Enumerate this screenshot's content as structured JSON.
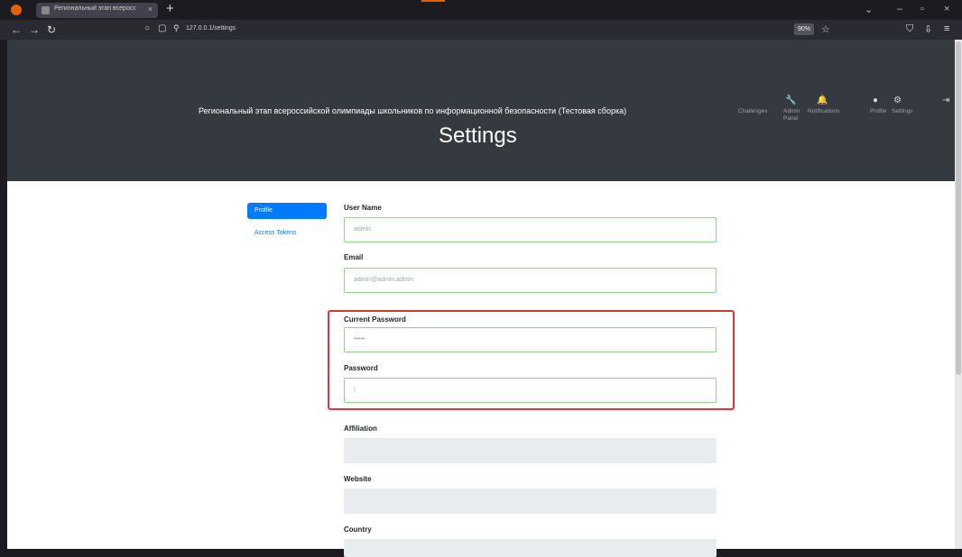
{
  "browser": {
    "tab_title": "Региональный этап всеросс",
    "url": "127.0.0.1/settings",
    "zoom": "90%"
  },
  "site": {
    "title": "Региональный этап всероссийской олимпиады школьников по информационной безопасности (Тестовая сборка)",
    "nav": [
      "Challenges",
      "Admin Panel",
      "Notifications",
      "Profile",
      "Settings"
    ]
  },
  "page": {
    "title": "Settings"
  },
  "sidebar": {
    "profile": "Profile",
    "tokens": "Access Tokens"
  },
  "form": {
    "username_label": "User Name",
    "username": "admin",
    "email_label": "Email",
    "email": "admin@admin.admin",
    "current_password_label": "Current Password",
    "current_password": "•••••",
    "password_label": "Password",
    "password": "|",
    "affiliation_label": "Affiliation",
    "website_label": "Website",
    "country_label": "Country"
  }
}
